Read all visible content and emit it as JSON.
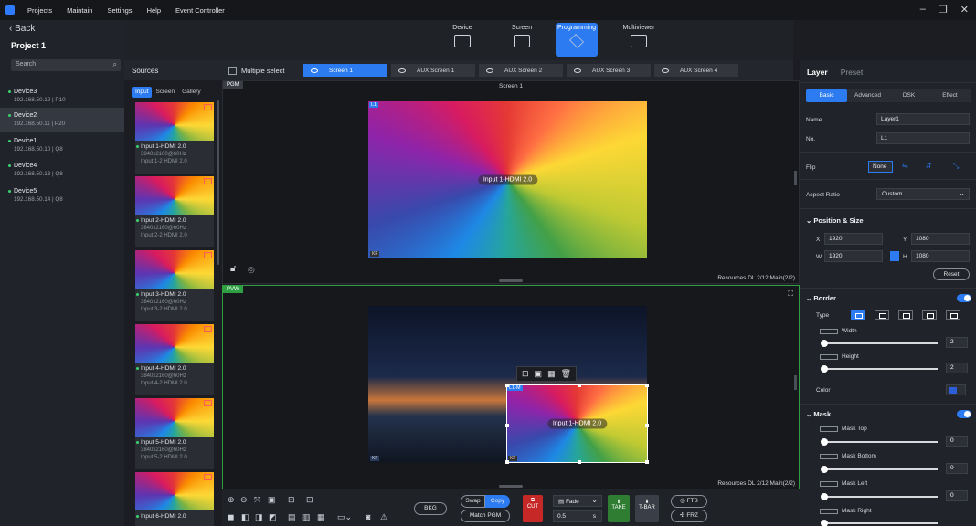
{
  "menubar": {
    "items": [
      "Projects",
      "Maintain",
      "Settings",
      "Help",
      "Event Controller"
    ]
  },
  "left": {
    "back": "Back",
    "project": "Project 1",
    "search_placeholder": "Search",
    "devices": [
      {
        "name": "Device3",
        "info": "192.168.50.12 | P10"
      },
      {
        "name": "Device2",
        "info": "192.168.50.11 | P20"
      },
      {
        "name": "Device1",
        "info": "192.168.50.10 | Q8"
      },
      {
        "name": "Device4",
        "info": "192.168.50.13 | Q8"
      },
      {
        "name": "Device5",
        "info": "192.168.50.14 | Q8"
      }
    ]
  },
  "topnav": {
    "items": [
      "Device",
      "Screen",
      "Programming",
      "Multiviewer"
    ],
    "active": "Programming"
  },
  "sources": {
    "title": "Sources",
    "tabs": [
      "Input",
      "Screen",
      "Gallery"
    ],
    "items": [
      {
        "name": "Input 1-HDMI 2.0",
        "res": "3840x2160@60Hz",
        "port": "Input 1-2  HDMI 2.0"
      },
      {
        "name": "Input 2-HDMI 2.0",
        "res": "3840x2160@60Hz",
        "port": "Input 2-2  HDMI 2.0"
      },
      {
        "name": "Input 3-HDMI 2.0",
        "res": "3840x2160@60Hz",
        "port": "Input 3-2  HDMI 2.0"
      },
      {
        "name": "Input 4-HDMI 2.0",
        "res": "3840x2160@60Hz",
        "port": "Input 4-2  HDMI 2.0"
      },
      {
        "name": "Input 5-HDMI 2.0",
        "res": "3840x2160@60Hz",
        "port": "Input 5-2  HDMI 2.0"
      },
      {
        "name": "Input 6-HDMI 2.0",
        "res": "",
        "port": ""
      }
    ]
  },
  "screentabs": {
    "multiple_select": "Multiple select",
    "tabs": [
      "Screen 1",
      "AUX Screen 1",
      "AUX Screen 2",
      "AUX Screen 3",
      "AUX Screen 4"
    ]
  },
  "pgm": {
    "label": "PGM",
    "title": "Screen 1",
    "layer_tag": "L1",
    "layer_name": "Input 1-HDMI 2.0",
    "kf": "KF",
    "resources": "Resources DL   2/12 Main(2/2)"
  },
  "pvw": {
    "label": "PVW",
    "layer_tag": "L1-M",
    "layer_name": "Input 1-HDMI 2.0",
    "kf": "KF",
    "resources": "Resources DL   2/12 Main(2/2)"
  },
  "bottom": {
    "bkg": "BKG",
    "swap": "Swap",
    "copy": "Copy",
    "match": "Match PGM",
    "cut": "CUT",
    "transition": "Fade",
    "duration": "0.5",
    "duration_unit": "s",
    "take": "TAKE",
    "tbar": "T-BAR",
    "ftb": "FTB",
    "frz": "FRZ"
  },
  "right": {
    "tabs": [
      "Layer",
      "Preset"
    ],
    "subtabs": [
      "Basic",
      "Advanced",
      "DSK",
      "Effect"
    ],
    "name_label": "Name",
    "name_value": "Layer1",
    "no_label": "No.",
    "no_value": "L1",
    "flip_label": "Flip",
    "flip_value": "None",
    "aspect_label": "Aspect Ratio",
    "aspect_value": "Custom",
    "pos_title": "Position & Size",
    "x": "1920",
    "y": "1080",
    "w": "1920",
    "h": "1080",
    "x_label": "X",
    "y_label": "Y",
    "w_label": "W",
    "h_label": "H",
    "reset": "Reset",
    "border_title": "Border",
    "type_label": "Type",
    "width_label": "Width",
    "height_label": "Height",
    "border_width": "2",
    "border_height": "2",
    "color_label": "Color",
    "mask_title": "Mask",
    "mask_top": "Mask Top",
    "mask_bottom": "Mask Bottom",
    "mask_left": "Mask Left",
    "mask_right": "Mask Right",
    "mask_value": "0",
    "accent": "#2c7bf0"
  }
}
